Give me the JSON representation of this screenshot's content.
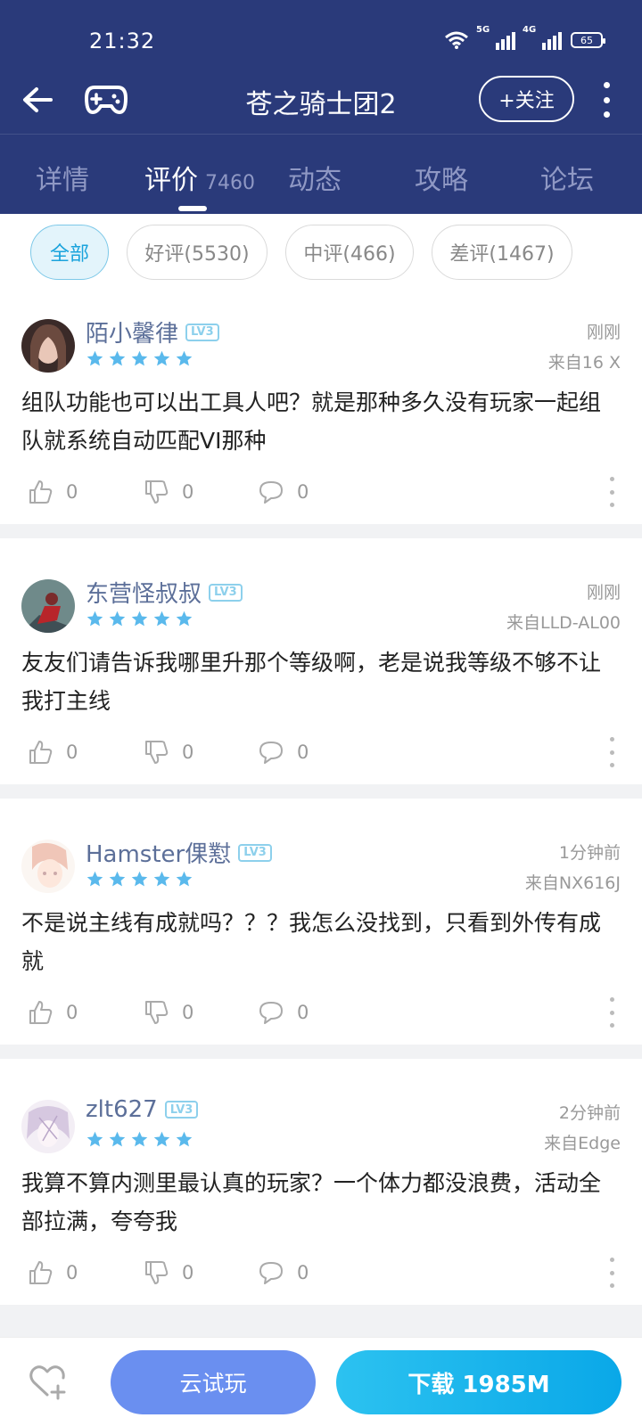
{
  "status_bar": {
    "time": "21:32",
    "network_1": "5G",
    "network_2": "4G",
    "battery": "65"
  },
  "topbar": {
    "title": "苍之骑士团2",
    "follow_label": "+关注"
  },
  "tabs": [
    {
      "label": "详情",
      "count": ""
    },
    {
      "label": "评价",
      "count": "7460"
    },
    {
      "label": "动态",
      "count": ""
    },
    {
      "label": "攻略",
      "count": ""
    },
    {
      "label": "论坛",
      "count": ""
    }
  ],
  "filters": [
    {
      "label": "全部"
    },
    {
      "label": "好评(5530)"
    },
    {
      "label": "中评(466)"
    },
    {
      "label": "差评(1467)"
    }
  ],
  "reviews": [
    {
      "username": "陌小馨律",
      "level": "LV3",
      "rating": 5,
      "time": "刚刚",
      "device": "来自16 X",
      "text": "组队功能也可以出工具人吧？就是那种多久没有玩家一起组队就系统自动匹配VI那种",
      "likes": "0",
      "dislikes": "0",
      "comments": "0"
    },
    {
      "username": "东营怪叔叔",
      "level": "LV3",
      "rating": 5,
      "time": "刚刚",
      "device": "来自LLD-AL00",
      "text": "友友们请告诉我哪里升那个等级啊，老是说我等级不够不让我打主线",
      "likes": "0",
      "dislikes": "0",
      "comments": "0"
    },
    {
      "username": "Hamster倮懟",
      "level": "LV3",
      "rating": 5,
      "time": "1分钟前",
      "device": "来自NX616J",
      "text": "不是说主线有成就吗？？？我怎么没找到，只看到外传有成就",
      "likes": "0",
      "dislikes": "0",
      "comments": "0"
    },
    {
      "username": "zlt627",
      "level": "LV3",
      "rating": 5,
      "time": "2分钟前",
      "device": "来自Edge",
      "text": "我算不算内测里最认真的玩家？一个体力都没浪费，活动全部拉满，夸夸我",
      "likes": "0",
      "dislikes": "0",
      "comments": "0"
    }
  ],
  "bottom_bar": {
    "cloud_play_label": "云试玩",
    "download_label": "下载 1985M"
  },
  "colors": {
    "header_bg": "#2a3a7a",
    "accent_blue": "#1aa3dc",
    "star_blue": "#5ab9ec",
    "cloud_button": "#6a8ff0",
    "download_button": "#0aa8e8"
  }
}
